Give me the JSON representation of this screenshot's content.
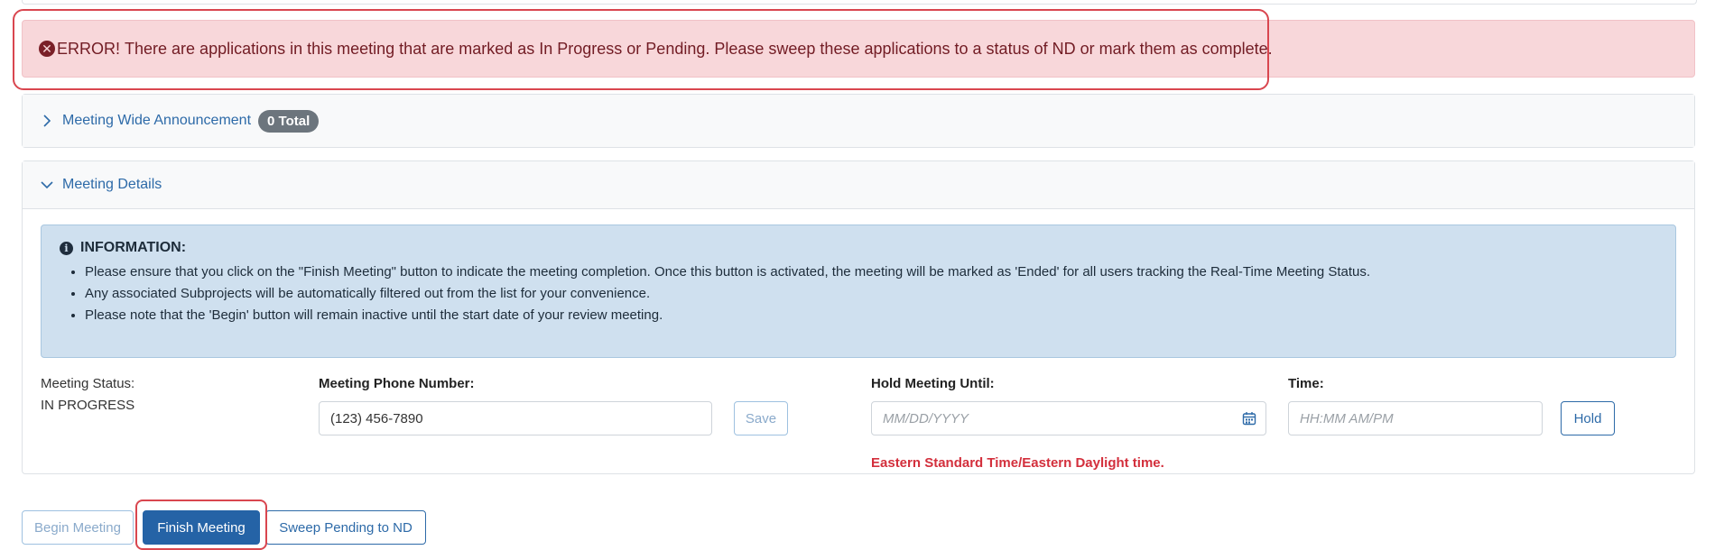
{
  "error_alert": {
    "icon": "error-circle-icon",
    "prefix": "ERROR!",
    "message": "There are applications in this meeting that are marked as In Progress or Pending. Please sweep these applications to a status of ND or mark them as complete."
  },
  "announcement": {
    "label": "Meeting Wide Announcement",
    "badge": "0 Total"
  },
  "details": {
    "label": "Meeting Details",
    "info": {
      "title": "INFORMATION:",
      "items": [
        "Please ensure that you click on the \"Finish Meeting\" button to indicate the meeting completion. Once this button is activated, the meeting will be marked as 'Ended' for all users tracking the Real-Time Meeting Status.",
        "Any associated Subprojects will be automatically filtered out from the list for your convenience.",
        "Please note that the 'Begin' button will remain inactive until the start date of your review meeting."
      ]
    },
    "status_label": "Meeting Status:",
    "status_value": "IN PROGRESS",
    "phone_label": "Meeting Phone Number:",
    "phone_value": "(123) 456-7890",
    "save_label": "Save",
    "hold_until_label": "Hold Meeting Until:",
    "date_placeholder": "MM/DD/YYYY",
    "time_label": "Time:",
    "time_placeholder": "HH:MM AM/PM",
    "hold_label": "Hold",
    "tz_note": "Eastern Standard Time/Eastern Daylight time."
  },
  "actions": {
    "begin": "Begin Meeting",
    "finish": "Finish Meeting",
    "sweep": "Sweep Pending to ND"
  },
  "colors": {
    "error_bg": "#f8d7da",
    "error_text": "#721c24",
    "info_bg": "#cfe0ef",
    "primary": "#2563a6",
    "highlight": "#d9464f",
    "tz_note": "#d32f3c"
  }
}
